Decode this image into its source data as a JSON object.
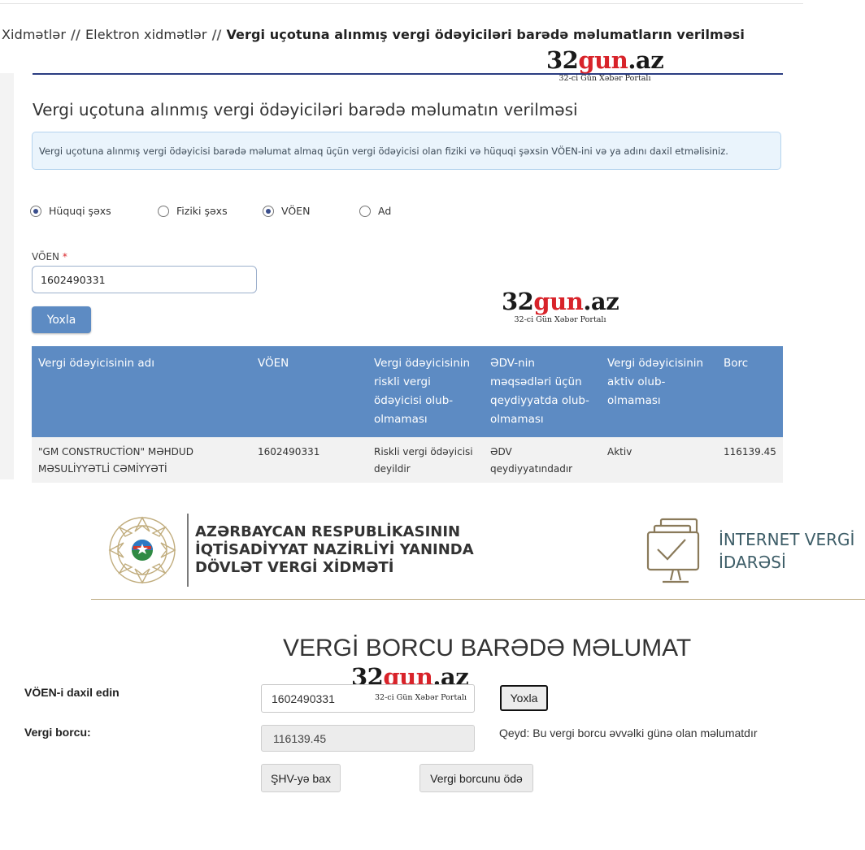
{
  "breadcrumb": {
    "items": [
      "Xidmətlər",
      "Elektron xidmətlər"
    ],
    "separator": "//",
    "current": "Vergi uçotuna alınmış vergi ödəyiciləri barədə məlumatların verilməsi"
  },
  "watermark": {
    "number": "32",
    "red": "gun",
    "tld": ".az",
    "sub": "32-ci Gün Xəbər Portalı"
  },
  "form": {
    "title": "Vergi uçotuna alınmış vergi ödəyiciləri barədə məlumatın verilməsi",
    "info": "Vergi uçotuna alınmış vergi ödəyicisi barədə məlumat almaq üçün vergi ödəyicisi olan fiziki və hüquqi şəxsin VÖEN-ini və ya adını daxil etməlisiniz.",
    "radios": {
      "legal": "Hüquqi şəxs",
      "physical": "Fiziki şəxs",
      "voen": "VÖEN",
      "name": "Ad"
    },
    "voen_label": "VÖEN",
    "required_mark": "*",
    "voen_value": "1602490331",
    "check_button": "Yoxla"
  },
  "table": {
    "headers": [
      "Vergi ödəyicisinin adı",
      "VÖEN",
      "Vergi ödəyicisinin riskli vergi ödəyicisi olub-olmaması",
      "ƏDV-nin məqsədləri üçün qeydiyyatda olub-olmaması",
      "Vergi ödəyicisinin aktiv olub-olmaması",
      "Borc"
    ],
    "row": [
      "\"GM CONSTRUCTİON\" MƏHDUD MƏSULİYYƏTLİ CƏMİYYƏTİ",
      "1602490331",
      "Riskli vergi ödəyicisi deyildir",
      "ƏDV qeydiyyatındadır",
      "Aktiv",
      "116139.45"
    ]
  },
  "lower": {
    "org": {
      "line1": "AZƏRBAYCAN RESPUBLİKASININ",
      "line2": "İQTİSADİYYAT NAZİRLİYİ YANINDA",
      "line3": "DÖVLƏT VERGİ XİDMƏTİ"
    },
    "portal": {
      "line1": "İNTERNET VERGİ",
      "line2": "İDARƏSİ"
    },
    "title": "VERGİ BORCU BARƏDƏ MƏLUMAT",
    "voen_label": "VÖEN-i daxil edin",
    "voen_value": "1602490331",
    "check_button": "Yoxla",
    "debt_label": "Vergi borcu:",
    "debt_value": "116139.45",
    "note": "Qeyd: Bu vergi borcu əvvəlki günə olan məlumatdır",
    "shv_button": "ŞHV-yə bax",
    "pay_button": "Vergi borcunu ödə"
  },
  "colors": {
    "accent_blue": "#5d8bc3",
    "watermark_red": "#d8232a",
    "required_red": "#d9262c"
  }
}
